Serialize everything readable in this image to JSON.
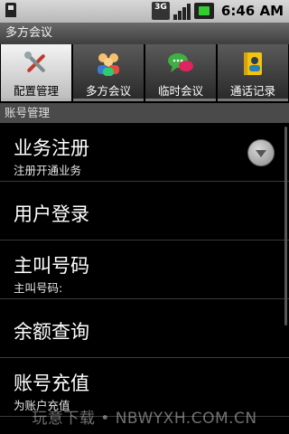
{
  "status": {
    "network": "3G",
    "time": "6:46 AM"
  },
  "app": {
    "title": "多方会议"
  },
  "tabs": [
    {
      "label": "配置管理",
      "icon": "tools-icon",
      "active": true
    },
    {
      "label": "多方会议",
      "icon": "group-icon",
      "active": false
    },
    {
      "label": "临时会议",
      "icon": "chat-icon",
      "active": false
    },
    {
      "label": "通话记录",
      "icon": "contact-book-icon",
      "active": false
    }
  ],
  "section": {
    "title": "账号管理"
  },
  "items": [
    {
      "title": "业务注册",
      "subtitle": "注册开通业务"
    },
    {
      "title": "用户登录"
    },
    {
      "title": "主叫号码",
      "subtitle": "主叫号码:"
    },
    {
      "title": "余额查询"
    },
    {
      "title": "账号充值",
      "subtitle": "为账户充值"
    }
  ],
  "watermark": "玩意下载 • NBWYXH.COM.CN",
  "colors": {
    "accent_green": "#3c3",
    "section_bg": "#4a4a4a"
  }
}
